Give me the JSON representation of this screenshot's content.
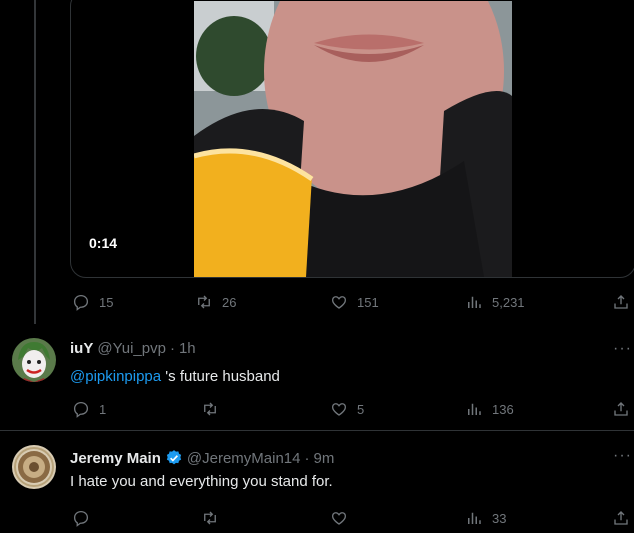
{
  "main_post": {
    "video_duration": "0:14",
    "stats": {
      "replies": "15",
      "reposts": "26",
      "likes": "151",
      "views": "5,231"
    }
  },
  "replies": [
    {
      "name": "iuY",
      "handle": "@Yui_pvp",
      "time": "1h",
      "mention": "@pipkinpippa",
      "text": " 's future husband",
      "stats": {
        "replies": "1",
        "reposts": "",
        "likes": "5",
        "views": "136"
      }
    },
    {
      "name": "Jeremy Main",
      "handle": "@JeremyMain14",
      "time": "9m",
      "text": "I hate you and everything you stand for.",
      "stats": {
        "replies": "",
        "reposts": "",
        "likes": "",
        "views": "33"
      }
    }
  ],
  "ui": {
    "dot": "·",
    "more": "···"
  },
  "colors": {
    "accent": "#1d9bf0",
    "muted": "#71767b",
    "verified": "#1d9bf0"
  },
  "icons": [
    "reply-icon",
    "repost-icon",
    "like-icon",
    "views-icon",
    "share-icon",
    "verified-icon",
    "more-icon"
  ]
}
